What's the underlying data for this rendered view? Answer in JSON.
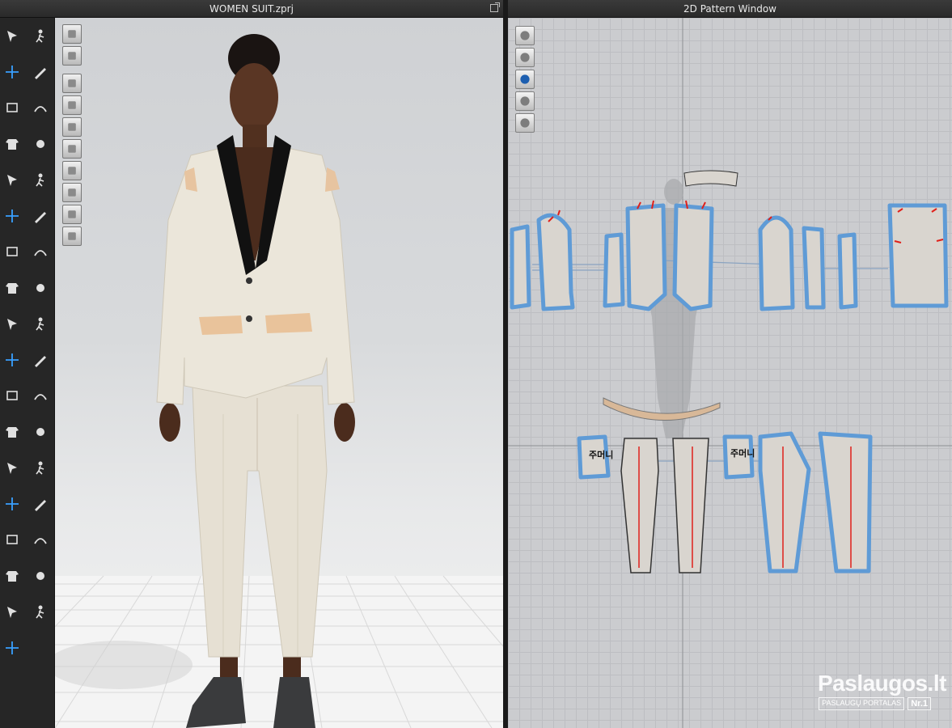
{
  "window_3d": {
    "title": "WOMEN SUIT.zprj",
    "left_tools": [
      "select-arrow-icon",
      "walk-avatar-icon",
      "move-crosshair-icon",
      "tack-icon",
      "edit-pattern-icon",
      "fold-icon",
      "shirt-icon",
      "needle-icon",
      "transform-icon",
      "pin-icon",
      "bounding-icon",
      "pin-multi-icon",
      "arrangement-icon",
      "grid-layout-icon",
      "measure-icon",
      "sewing-icon",
      "strap-icon",
      "button-icon",
      "fabric-icon",
      "buttonhole-icon",
      "garment-fit-icon",
      "zipper-icon",
      "trims-icon",
      "puckering-icon",
      "gradient-icon",
      "topstitch-icon",
      "avatar-icon",
      "texture-icon",
      "fold-arrange-icon",
      "graphic-icon",
      "ruler-icon",
      "shrink-icon",
      "hanger-icon",
      "piping-icon",
      "smocking-icon"
    ],
    "viewport_tools": [
      "simulation-icon",
      "show-garment-icon",
      "show-avatar-icon",
      "fabric-render-icon",
      "avatar-visibility-icon",
      "hdri-icon",
      "texture-surface-icon",
      "shaded-icon",
      "skin-icon",
      "globe-icon"
    ]
  },
  "window_2d": {
    "title": "2D Pattern Window",
    "tools": [
      "pen-icon",
      "garment-icon",
      "info-icon",
      "layers-icon",
      "lock-garment-icon"
    ],
    "pattern_labels": [
      "주머니",
      "주머니"
    ]
  },
  "watermark": {
    "brand": "Paslaugos.lt",
    "tagline": "PASLAUGŲ PORTALAS",
    "badge": "Nr.1"
  }
}
